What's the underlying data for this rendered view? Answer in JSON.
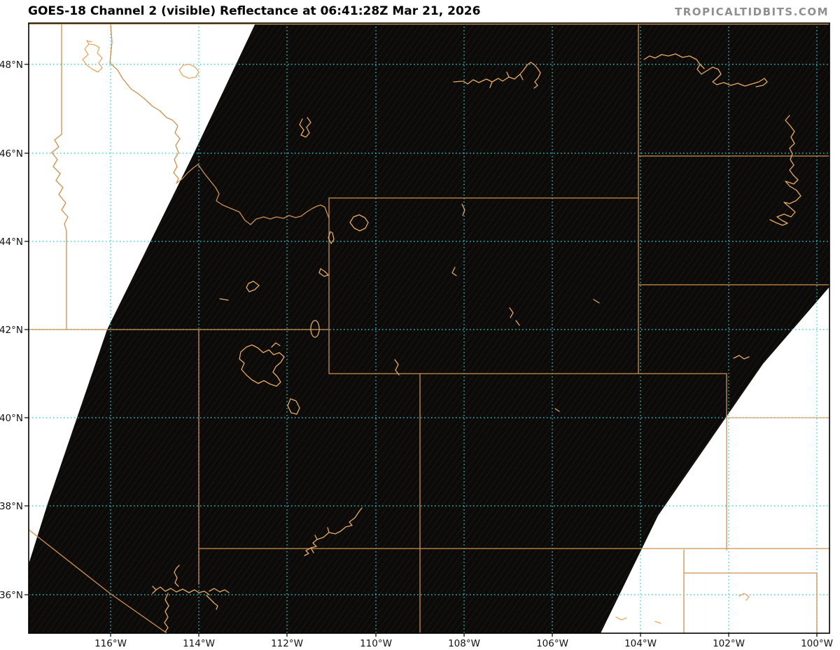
{
  "header": {
    "title": "GOES-18 Channel 2 (visible) Reflectance at 06:41:28Z Mar 21, 2026",
    "watermark": "TROPICALTIDBITS.COM"
  },
  "map": {
    "x_axis": {
      "labels": [
        "116°W",
        "114°W",
        "112°W",
        "110°W",
        "108°W",
        "106°W",
        "104°W",
        "102°W",
        "100°W"
      ]
    },
    "y_axis": {
      "labels": [
        "48°N",
        "46°N",
        "44°N",
        "42°N",
        "40°N",
        "38°N",
        "36°N"
      ]
    },
    "colors": {
      "background": "#ffffff",
      "night_satellite": "#0c0b09",
      "no_data": "#ffffff",
      "gridline": "#2ccfd6",
      "state_border": "#cf8f4e",
      "water_outline": "#e6aa62",
      "canada_border": "#d39a5e",
      "frame": "#000000",
      "watermark": "#8f8f8f",
      "title_text": "#000000"
    },
    "features": {
      "imagery": "night-time visible satellite (black, no sunlight)",
      "no_data_regions": "white wedges at upper-left and lower-right (edge of scan sector)",
      "overlays": [
        "US-Canada border 49N",
        "state boundaries",
        "major lakes and rivers outlines",
        "2-degree lat/lon dashed graticule"
      ]
    }
  }
}
